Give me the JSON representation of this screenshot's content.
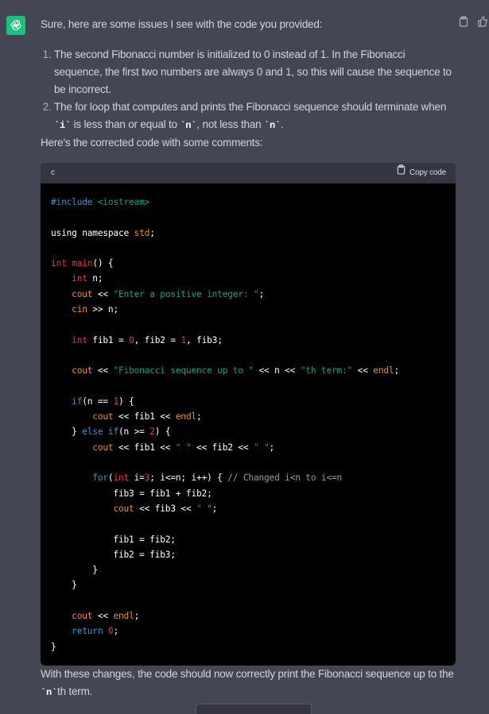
{
  "response": {
    "intro": "Sure, here are some issues I see with the code you provided:",
    "issues": [
      {
        "parts": [
          {
            "text": "The second Fibonacci number is initialized to 0 instead of 1. In the Fibonacci sequence, the first two numbers are always 0 and 1, so this will cause the sequence to be incorrect.",
            "code": false
          }
        ]
      },
      {
        "parts": [
          {
            "text": "The for loop that computes and prints the Fibonacci sequence should terminate when ",
            "code": false
          },
          {
            "text": "`i`",
            "code": true
          },
          {
            "text": " is less than or equal to ",
            "code": false
          },
          {
            "text": "`n`",
            "code": true
          },
          {
            "text": ", not less than ",
            "code": false
          },
          {
            "text": "`n`",
            "code": true
          },
          {
            "text": ".",
            "code": false
          }
        ]
      }
    ],
    "lead_in": "Here's the corrected code with some comments:",
    "code_block": {
      "language": "c",
      "copy_label": "Copy code",
      "lines": [
        [
          {
            "t": "#include ",
            "c": "preproc"
          },
          {
            "t": "<iostream>",
            "c": "include"
          }
        ],
        [],
        [
          {
            "t": "using namespace ",
            "c": "default"
          },
          {
            "t": "std",
            "c": "func"
          },
          {
            "t": ";",
            "c": "default"
          }
        ],
        [],
        [
          {
            "t": "int",
            "c": "type"
          },
          {
            "t": " ",
            "c": "default"
          },
          {
            "t": "main",
            "c": "type"
          },
          {
            "t": "() {",
            "c": "default"
          }
        ],
        [
          {
            "t": "    ",
            "c": "default"
          },
          {
            "t": "int",
            "c": "type"
          },
          {
            "t": " n;",
            "c": "default"
          }
        ],
        [
          {
            "t": "    ",
            "c": "default"
          },
          {
            "t": "cout",
            "c": "func"
          },
          {
            "t": " << ",
            "c": "default"
          },
          {
            "t": "\"Enter a positive integer: \"",
            "c": "string"
          },
          {
            "t": ";",
            "c": "default"
          }
        ],
        [
          {
            "t": "    ",
            "c": "default"
          },
          {
            "t": "cin",
            "c": "func"
          },
          {
            "t": " >> n;",
            "c": "default"
          }
        ],
        [],
        [
          {
            "t": "    ",
            "c": "default"
          },
          {
            "t": "int",
            "c": "type"
          },
          {
            "t": " fib1 = ",
            "c": "default"
          },
          {
            "t": "0",
            "c": "number"
          },
          {
            "t": ", fib2 = ",
            "c": "default"
          },
          {
            "t": "1",
            "c": "number"
          },
          {
            "t": ", fib3;",
            "c": "default"
          }
        ],
        [],
        [
          {
            "t": "    ",
            "c": "default"
          },
          {
            "t": "cout",
            "c": "func"
          },
          {
            "t": " << ",
            "c": "default"
          },
          {
            "t": "\"Fibonacci sequence up to \"",
            "c": "string"
          },
          {
            "t": " << n << ",
            "c": "default"
          },
          {
            "t": "\"th term:\"",
            "c": "string"
          },
          {
            "t": " << ",
            "c": "default"
          },
          {
            "t": "endl",
            "c": "func"
          },
          {
            "t": ";",
            "c": "default"
          }
        ],
        [],
        [
          {
            "t": "    ",
            "c": "default"
          },
          {
            "t": "if",
            "c": "keyword"
          },
          {
            "t": "(n == ",
            "c": "default"
          },
          {
            "t": "1",
            "c": "number"
          },
          {
            "t": ") {",
            "c": "default"
          }
        ],
        [
          {
            "t": "        ",
            "c": "default"
          },
          {
            "t": "cout",
            "c": "func"
          },
          {
            "t": " << fib1 << ",
            "c": "default"
          },
          {
            "t": "endl",
            "c": "func"
          },
          {
            "t": ";",
            "c": "default"
          }
        ],
        [
          {
            "t": "    } ",
            "c": "default"
          },
          {
            "t": "else",
            "c": "keyword"
          },
          {
            "t": " ",
            "c": "default"
          },
          {
            "t": "if",
            "c": "keyword"
          },
          {
            "t": "(n >= ",
            "c": "default"
          },
          {
            "t": "2",
            "c": "number"
          },
          {
            "t": ") {",
            "c": "default"
          }
        ],
        [
          {
            "t": "        ",
            "c": "default"
          },
          {
            "t": "cout",
            "c": "func"
          },
          {
            "t": " << fib1 << ",
            "c": "default"
          },
          {
            "t": "\" \"",
            "c": "string"
          },
          {
            "t": " << fib2 << ",
            "c": "default"
          },
          {
            "t": "\" \"",
            "c": "string"
          },
          {
            "t": ";",
            "c": "default"
          }
        ],
        [],
        [
          {
            "t": "        ",
            "c": "default"
          },
          {
            "t": "for",
            "c": "keyword"
          },
          {
            "t": "(",
            "c": "default"
          },
          {
            "t": "int",
            "c": "type"
          },
          {
            "t": " i=",
            "c": "default"
          },
          {
            "t": "3",
            "c": "number"
          },
          {
            "t": "; i<=n; i++) { ",
            "c": "default"
          },
          {
            "t": "// Changed i<n to i<=n",
            "c": "comment"
          }
        ],
        [
          {
            "t": "            fib3 = fib1 + fib2;",
            "c": "default"
          }
        ],
        [
          {
            "t": "            ",
            "c": "default"
          },
          {
            "t": "cout",
            "c": "func"
          },
          {
            "t": " << fib3 << ",
            "c": "default"
          },
          {
            "t": "\" \"",
            "c": "string"
          },
          {
            "t": ";",
            "c": "default"
          }
        ],
        [],
        [
          {
            "t": "            fib1 = fib2;",
            "c": "default"
          }
        ],
        [
          {
            "t": "            fib2 = fib3;",
            "c": "default"
          }
        ],
        [
          {
            "t": "        }",
            "c": "default"
          }
        ],
        [
          {
            "t": "    }",
            "c": "default"
          }
        ],
        [],
        [
          {
            "t": "    ",
            "c": "default"
          },
          {
            "t": "cout",
            "c": "func"
          },
          {
            "t": " << ",
            "c": "default"
          },
          {
            "t": "endl",
            "c": "func"
          },
          {
            "t": ";",
            "c": "default"
          }
        ],
        [
          {
            "t": "    ",
            "c": "default"
          },
          {
            "t": "return",
            "c": "keyword"
          },
          {
            "t": " ",
            "c": "default"
          },
          {
            "t": "0",
            "c": "number"
          },
          {
            "t": ";",
            "c": "default"
          }
        ],
        [
          {
            "t": "}",
            "c": "default"
          }
        ]
      ]
    },
    "closing_parts": [
      {
        "text": "With these changes, the code should now correctly print the Fibonacci sequence up to the ",
        "code": false
      },
      {
        "text": "`n`",
        "code": true
      },
      {
        "text": "th term.",
        "code": false
      }
    ]
  },
  "icons": {
    "avatar": "openai-logo-icon",
    "copy": "clipboard-icon",
    "thumbs_up": "thumbs-up-icon"
  },
  "colors": {
    "background": "#444654",
    "avatar": "#19c37d",
    "code_bg": "#000000",
    "code_header_bg": "#343541"
  }
}
